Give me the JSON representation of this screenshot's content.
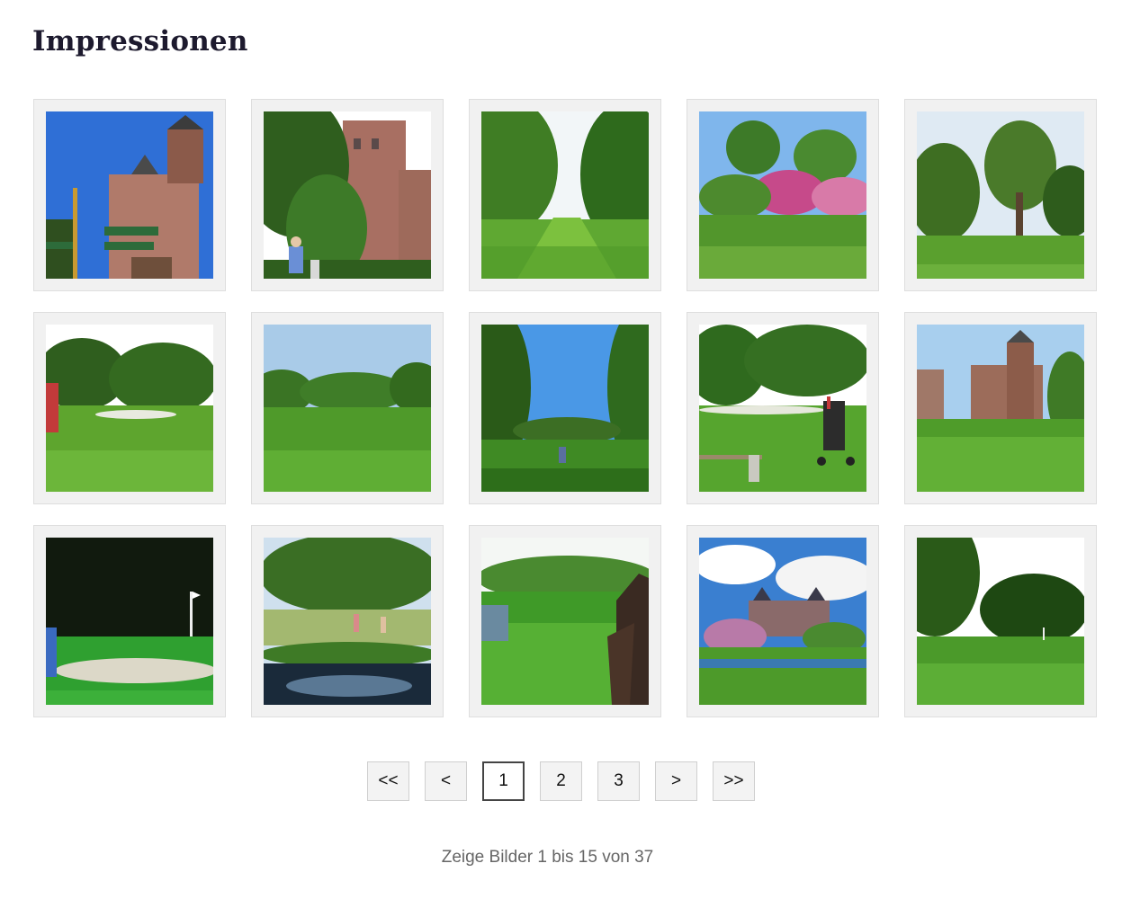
{
  "page": {
    "title": "Impressionen"
  },
  "gallery": {
    "images": [
      {
        "subject": "castle-with-signpost",
        "sky": "#2f6fd6",
        "ground": "#3d6b2a"
      },
      {
        "subject": "castle-with-golfers",
        "sky": "#ffffff",
        "ground": "#2f5e1e"
      },
      {
        "subject": "fairway-avenue-of-trees",
        "sky": "#f2f6f8",
        "ground": "#5fa832"
      },
      {
        "subject": "fairway-with-blossoming-trees",
        "sky": "#7fb6ec",
        "ground": "#52962c"
      },
      {
        "subject": "fairway-with-willow",
        "sky": "#dfeaf3",
        "ground": "#5aa02e"
      },
      {
        "subject": "green-with-bunker",
        "sky": "#ffffff",
        "ground": "#5ea52e"
      },
      {
        "subject": "open-fairway",
        "sky": "#a9cbe8",
        "ground": "#4f9a2a"
      },
      {
        "subject": "fairway-through-trees",
        "sky": "#4a98e6",
        "ground": "#3f8a24"
      },
      {
        "subject": "golf-bag-and-bench",
        "sky": "#ffffff",
        "ground": "#56a52e"
      },
      {
        "subject": "castle-across-fairway",
        "sky": "#a8cfee",
        "ground": "#4f9c2a"
      },
      {
        "subject": "bunker-with-flag",
        "sky": "#0c140a",
        "ground": "#2fa030"
      },
      {
        "subject": "pond-putting-area",
        "sky": "#cfe0ee",
        "ground": "#6c8f3a"
      },
      {
        "subject": "driving-range-sculpture",
        "sky": "#f4f7f4",
        "ground": "#3f9a28"
      },
      {
        "subject": "castle-with-clouds",
        "sky": "#3a7fd0",
        "ground": "#4d9a2a"
      },
      {
        "subject": "green-under-trees",
        "sky": "#ffffff",
        "ground": "#4b9a2a"
      }
    ]
  },
  "pagination": {
    "first_label": "<<",
    "prev_label": "<",
    "pages": [
      "1",
      "2",
      "3"
    ],
    "current_page": "1",
    "next_label": ">",
    "last_label": ">>"
  },
  "status": {
    "text": "Zeige Bilder 1 bis 15 von 37"
  },
  "colors": {
    "title": "#1d1a2e",
    "thumb_frame": "#f1f1f1",
    "active_border": "#444444",
    "status_text": "#666666"
  }
}
